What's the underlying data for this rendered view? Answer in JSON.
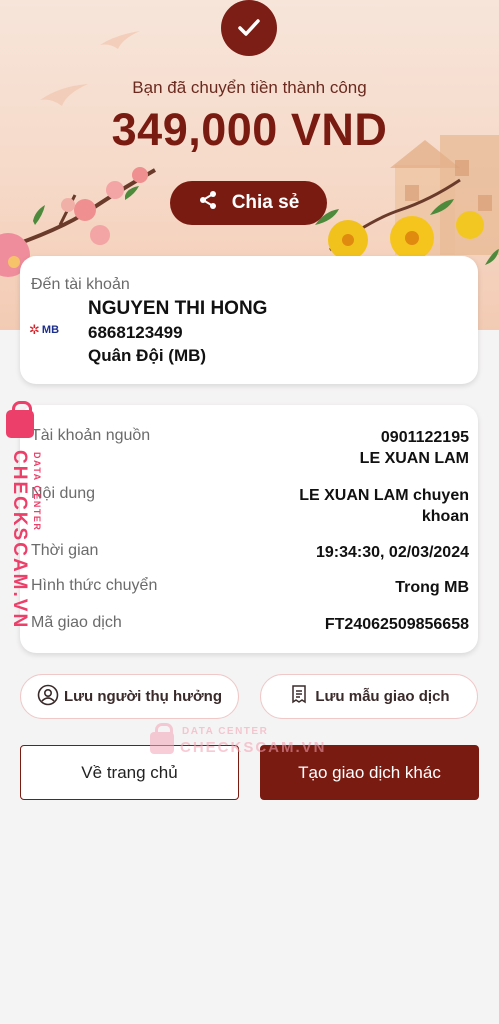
{
  "header": {
    "success_message": "Bạn đã chuyển tiền thành công",
    "amount": "349,000 VND",
    "share_label": "Chia sẻ"
  },
  "recipient": {
    "label": "Đến tài khoản",
    "bank_logo_text": "MB",
    "name": "NGUYEN THI HONG",
    "account_number": "6868123499",
    "bank_name": "Quân Đội (MB)"
  },
  "details": {
    "source_account": {
      "label": "Tài khoản nguồn",
      "number": "0901122195",
      "name": "LE XUAN LAM"
    },
    "content": {
      "label": "Nội dung",
      "line1": "LE XUAN LAM chuyen",
      "line2": "khoan"
    },
    "time": {
      "label": "Thời gian",
      "value": "19:34:30, 02/03/2024"
    },
    "transfer_type": {
      "label": "Hình thức chuyển",
      "value": "Trong MB"
    },
    "transaction_code": {
      "label": "Mã giao dịch",
      "value": "FT24062509856658"
    }
  },
  "actions": {
    "save_recipient": "Lưu người thụ hưởng",
    "save_template": "Lưu mẫu giao dịch",
    "home": "Về trang chủ",
    "new_transaction": "Tạo giao dịch khác"
  },
  "watermark": {
    "brand": "CHECKSCAM.VN",
    "caption": "DATA CENTER"
  },
  "colors": {
    "brand": "#7a1b12",
    "watermark": "#ec3f6a"
  },
  "icons": [
    "check-icon",
    "share-icon",
    "user-circle-icon",
    "receipt-icon",
    "lock-icon"
  ]
}
